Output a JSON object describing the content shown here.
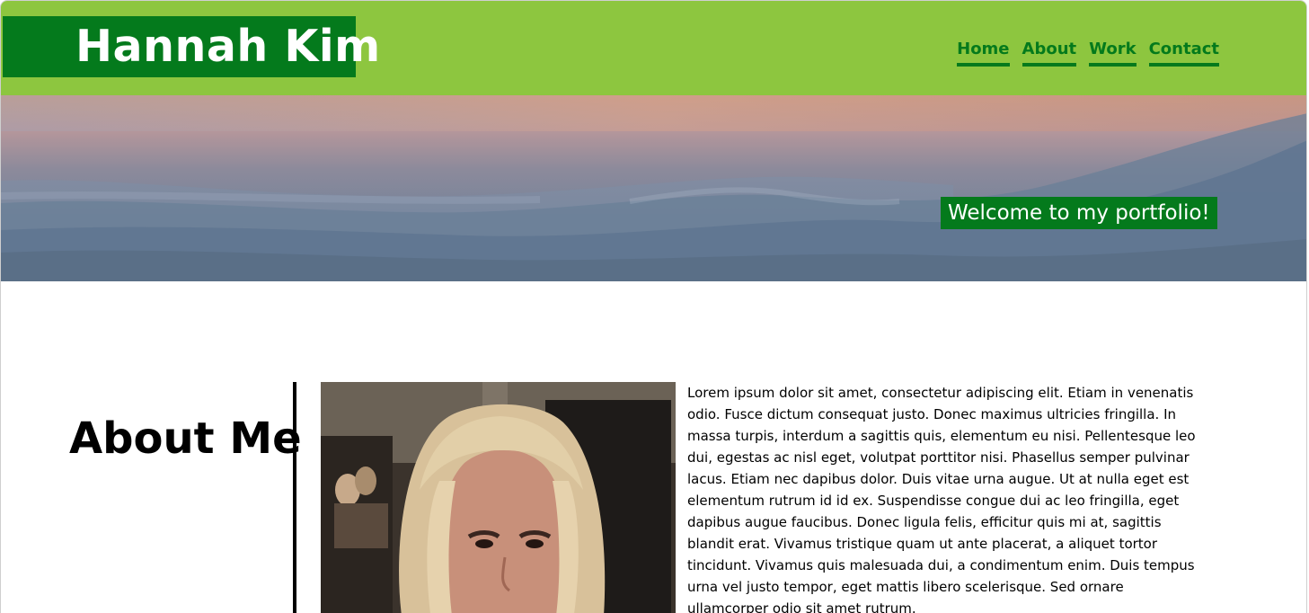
{
  "header": {
    "site_name": "Hannah Kim",
    "nav": [
      {
        "label": "Home"
      },
      {
        "label": "About"
      },
      {
        "label": "Work"
      },
      {
        "label": "Contact"
      }
    ]
  },
  "hero": {
    "welcome_text": "Welcome to my portfolio!"
  },
  "about": {
    "heading": "About Me",
    "body": "Lorem ipsum dolor sit amet, consectetur adipiscing elit. Etiam in venenatis odio. Fusce dictum consequat justo. Donec maximus ultricies fringilla. In massa turpis, interdum a sagittis quis, elementum eu nisi. Pellentesque leo dui, egestas ac nisl eget, volutpat porttitor nisi. Phasellus semper pulvinar lacus. Etiam nec dapibus dolor. Duis vitae urna augue. Ut at nulla eget est elementum rutrum id id ex. Suspendisse congue dui ac leo fringilla, eget dapibus augue faucibus. Donec ligula felis, efficitur quis mi at, sagittis blandit erat. Vivamus tristique quam ut ante placerat, a aliquet tortor tincidunt. Vivamus quis malesuada dui, a condimentum enim. Duis tempus urna vel justo tempor, eget mattis libero scelerisque. Sed ornare ullamcorper odio sit amet rutrum."
  },
  "colors": {
    "header_bg": "#8dc63f",
    "brand_green": "#047a1c",
    "text": "#000000",
    "background": "#ffffff"
  }
}
